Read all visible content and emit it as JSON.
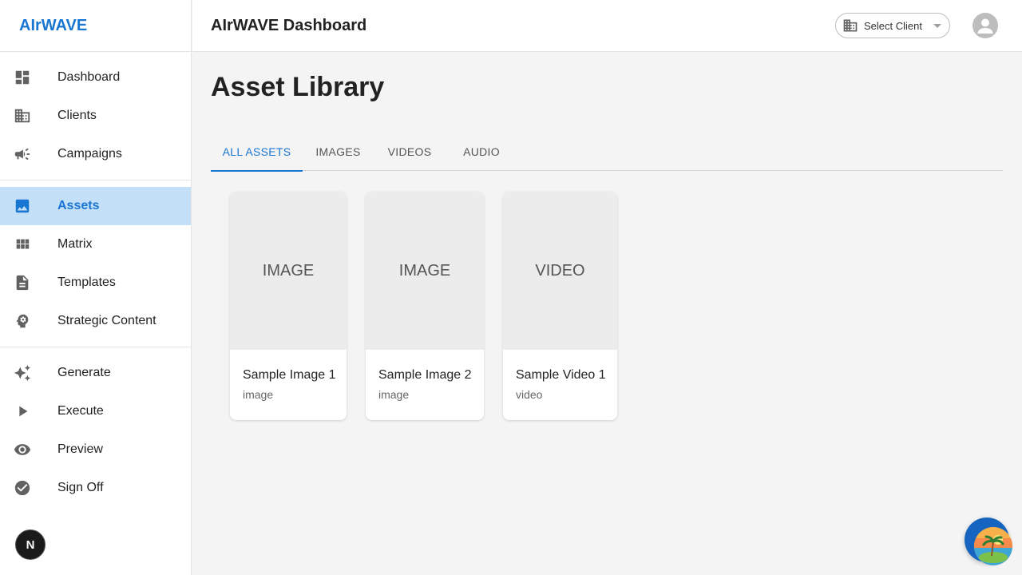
{
  "sidebar": {
    "brand": "AIrWAVE",
    "groups": [
      [
        {
          "label": "Dashboard",
          "icon": "dashboard-icon"
        },
        {
          "label": "Clients",
          "icon": "business-icon"
        },
        {
          "label": "Campaigns",
          "icon": "campaign-icon"
        }
      ],
      [
        {
          "label": "Assets",
          "icon": "image-icon",
          "active": true
        },
        {
          "label": "Matrix",
          "icon": "grid-icon"
        },
        {
          "label": "Templates",
          "icon": "description-icon"
        },
        {
          "label": "Strategic Content",
          "icon": "psychology-icon"
        }
      ],
      [
        {
          "label": "Generate",
          "icon": "auto-awesome-icon"
        },
        {
          "label": "Execute",
          "icon": "play-icon"
        },
        {
          "label": "Preview",
          "icon": "eye-icon"
        },
        {
          "label": "Sign Off",
          "icon": "check-circle-icon"
        }
      ]
    ],
    "dev_badge": "N"
  },
  "header": {
    "title": "AIrWAVE Dashboard",
    "client_select": {
      "label": "Select Client",
      "icon": "business-icon"
    },
    "avatar_icon": "person-icon"
  },
  "main": {
    "page_title": "Asset Library",
    "tabs": [
      {
        "label": "ALL ASSETS",
        "active": true
      },
      {
        "label": "IMAGES"
      },
      {
        "label": "VIDEOS"
      },
      {
        "label": "AUDIO"
      }
    ],
    "assets": [
      {
        "placeholder": "IMAGE",
        "name": "Sample Image 1",
        "type": "image"
      },
      {
        "placeholder": "IMAGE",
        "name": "Sample Image 2",
        "type": "image"
      },
      {
        "placeholder": "VIDEO",
        "name": "Sample Video 1",
        "type": "video"
      }
    ]
  },
  "colors": {
    "accent": "#1976d2",
    "active_bg": "#c4e0f8",
    "page_bg": "#f4f4f4",
    "fab": "#1565c0"
  },
  "fab_icon": "beach-island-icon"
}
